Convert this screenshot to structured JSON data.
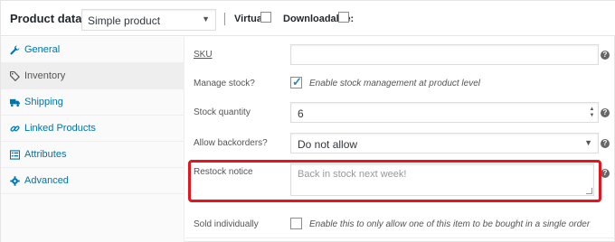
{
  "header": {
    "title": "Product data —",
    "product_type": "Simple product",
    "virtual_label": "Virtual:",
    "downloadable_label": "Downloadable:"
  },
  "sidebar": {
    "items": [
      {
        "label": "General",
        "icon": "wrench-icon"
      },
      {
        "label": "Inventory",
        "icon": "tag-icon"
      },
      {
        "label": "Shipping",
        "icon": "truck-icon"
      },
      {
        "label": "Linked Products",
        "icon": "link-icon"
      },
      {
        "label": "Attributes",
        "icon": "list-icon"
      },
      {
        "label": "Advanced",
        "icon": "gear-icon"
      }
    ],
    "active_index": 1
  },
  "form": {
    "sku_label": "SKU",
    "sku_value": "",
    "manage_stock_label": "Manage stock?",
    "manage_stock_text": "Enable stock management at product level",
    "manage_stock_checked": true,
    "stock_qty_label": "Stock quantity",
    "stock_qty_value": "6",
    "backorders_label": "Allow backorders?",
    "backorders_value": "Do not allow",
    "restock_label": "Restock notice",
    "restock_placeholder": "Back in stock next week!",
    "sold_individually_label": "Sold individually",
    "sold_individually_text": "Enable this to only allow one of this item to be bought in a single order",
    "sold_individually_checked": false,
    "help_glyph": "?"
  },
  "colors": {
    "link": "#0073aa",
    "highlight": "#e8141b",
    "checkmark": "#1e8cbe"
  }
}
